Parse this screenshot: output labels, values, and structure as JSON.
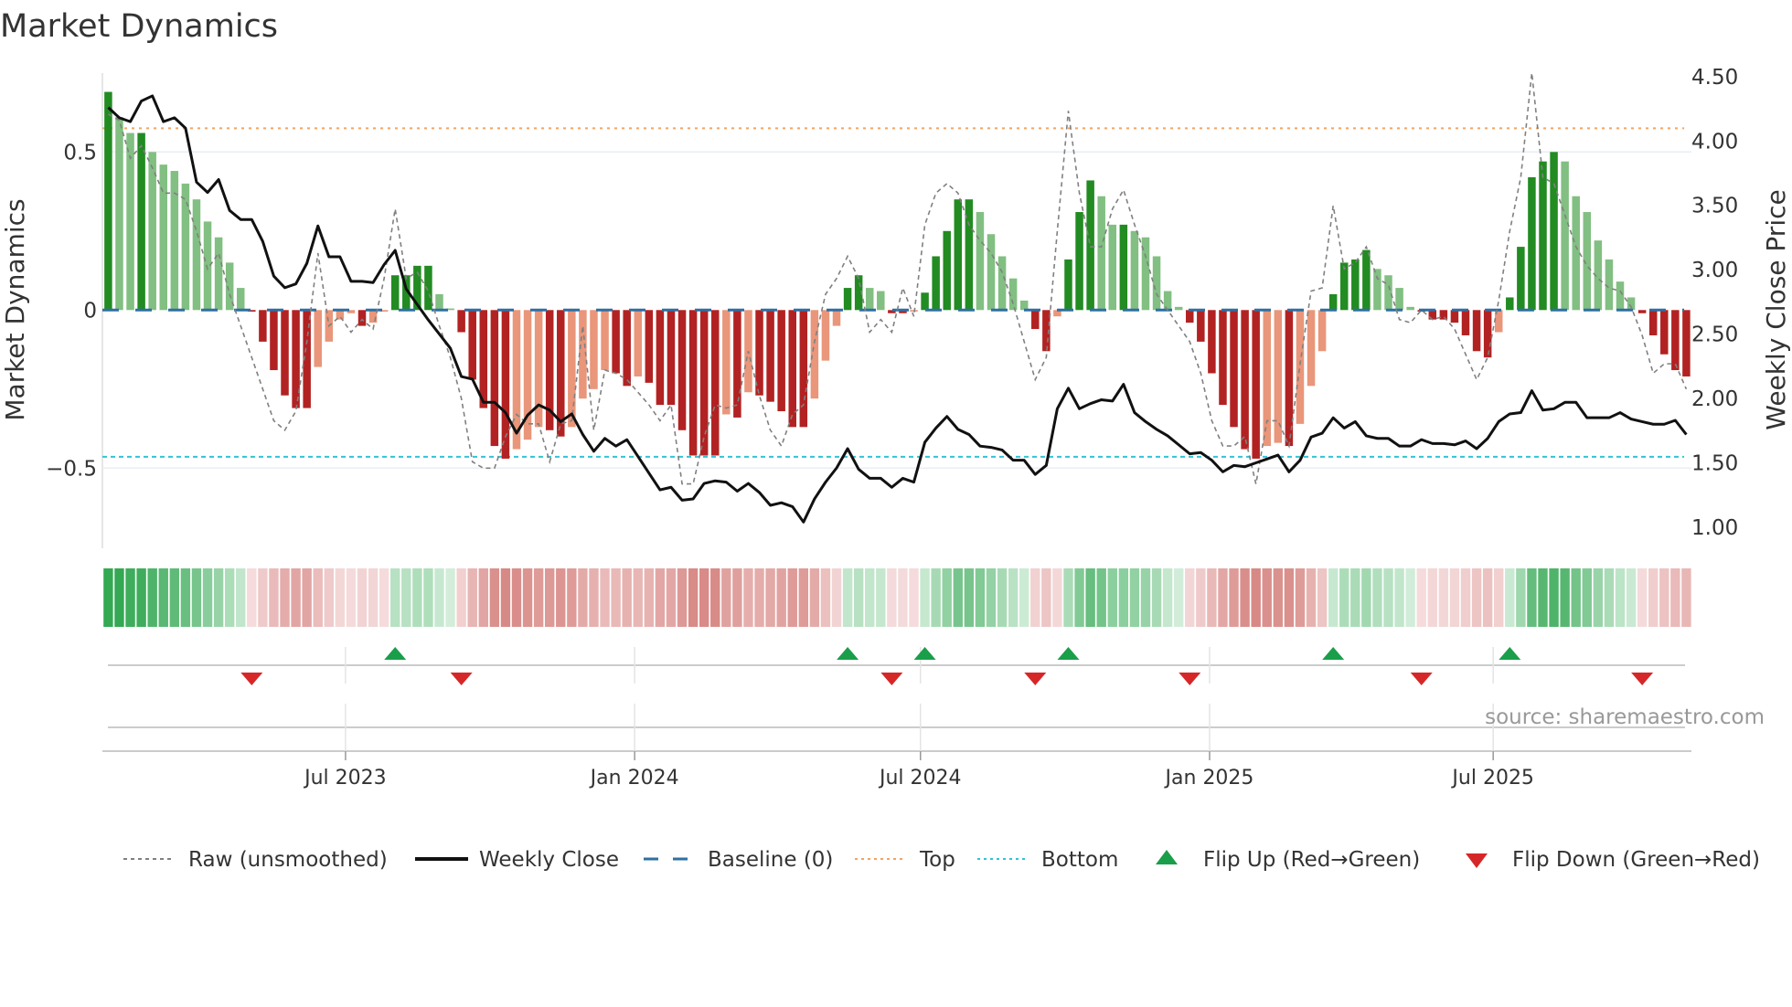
{
  "chart_data": {
    "type": "bar",
    "title": "Market Dynamics",
    "ylabel": "Market Dynamics",
    "ylabel_right": "Weekly Close Price",
    "ylim": [
      -0.75,
      0.75
    ],
    "ylim_right": [
      0.837,
      4.527
    ],
    "yticks": [
      {
        "v": 0.5,
        "label": "0.5"
      },
      {
        "v": 0,
        "label": "0"
      },
      {
        "v": -0.5,
        "label": "−0.5"
      }
    ],
    "yticks_right": [
      {
        "v": 4.5,
        "label": "4.50"
      },
      {
        "v": 4.0,
        "label": "4.00"
      },
      {
        "v": 3.5,
        "label": "3.50"
      },
      {
        "v": 3.0,
        "label": "3.00"
      },
      {
        "v": 2.5,
        "label": "2.50"
      },
      {
        "v": 2.0,
        "label": "2.00"
      },
      {
        "v": 1.5,
        "label": "1.50"
      },
      {
        "v": 1.0,
        "label": "1.00"
      }
    ],
    "xticks": [
      {
        "week": 21.5,
        "label": "Jul 2023"
      },
      {
        "week": 47.7,
        "label": "Jan 2024"
      },
      {
        "week": 73.6,
        "label": "Jul 2024"
      },
      {
        "week": 99.8,
        "label": "Jan 2025"
      },
      {
        "week": 125.5,
        "label": "Jul 2025"
      }
    ],
    "top_level": 0.575,
    "bottom_level": -0.464,
    "baseline": 0,
    "momentum": [
      0.69,
      0.61,
      0.56,
      0.56,
      0.5,
      0.46,
      0.44,
      0.4,
      0.35,
      0.28,
      0.23,
      0.15,
      0.07,
      -0.005,
      -0.1,
      -0.19,
      -0.27,
      -0.31,
      -0.31,
      -0.18,
      -0.1,
      -0.03,
      -0.01,
      -0.05,
      -0.04,
      -0.005,
      0.11,
      0.11,
      0.14,
      0.14,
      0.05,
      0.005,
      -0.07,
      -0.22,
      -0.31,
      -0.43,
      -0.47,
      -0.44,
      -0.41,
      -0.37,
      -0.38,
      -0.4,
      -0.37,
      -0.28,
      -0.25,
      -0.19,
      -0.2,
      -0.24,
      -0.21,
      -0.23,
      -0.3,
      -0.3,
      -0.38,
      -0.46,
      -0.46,
      -0.46,
      -0.33,
      -0.34,
      -0.26,
      -0.27,
      -0.29,
      -0.32,
      -0.37,
      -0.37,
      -0.28,
      -0.16,
      -0.05,
      0.07,
      0.11,
      0.07,
      0.06,
      -0.01,
      -0.01,
      -0.005,
      0.055,
      0.17,
      0.25,
      0.35,
      0.35,
      0.31,
      0.24,
      0.17,
      0.1,
      0.03,
      -0.06,
      -0.13,
      -0.02,
      0.16,
      0.31,
      0.41,
      0.36,
      0.27,
      0.27,
      0.25,
      0.23,
      0.17,
      0.06,
      0.01,
      -0.04,
      -0.1,
      -0.2,
      -0.3,
      -0.37,
      -0.44,
      -0.47,
      -0.43,
      -0.42,
      -0.43,
      -0.36,
      -0.24,
      -0.13,
      0.05,
      0.15,
      0.16,
      0.19,
      0.13,
      0.11,
      0.07,
      0.01,
      -0.005,
      -0.03,
      -0.03,
      -0.04,
      -0.08,
      -0.13,
      -0.15,
      -0.07,
      0.04,
      0.2,
      0.42,
      0.47,
      0.5,
      0.47,
      0.36,
      0.31,
      0.22,
      0.16,
      0.09,
      0.04,
      -0.01,
      -0.08,
      -0.14,
      -0.19,
      -0.21
    ],
    "raw": [
      0.62,
      0.6,
      0.48,
      0.52,
      0.45,
      0.37,
      0.37,
      0.35,
      0.25,
      0.13,
      0.18,
      0.05,
      -0.05,
      -0.15,
      -0.25,
      -0.35,
      -0.38,
      -0.32,
      -0.1,
      0.18,
      -0.05,
      -0.02,
      -0.07,
      -0.03,
      -0.06,
      0.1,
      0.32,
      0.1,
      0.12,
      0.06,
      -0.05,
      -0.15,
      -0.28,
      -0.48,
      -0.5,
      -0.5,
      -0.4,
      -0.33,
      -0.36,
      -0.36,
      -0.48,
      -0.36,
      -0.35,
      -0.05,
      -0.38,
      -0.19,
      -0.2,
      -0.22,
      -0.26,
      -0.3,
      -0.35,
      -0.3,
      -0.55,
      -0.55,
      -0.4,
      -0.3,
      -0.31,
      -0.3,
      -0.13,
      -0.27,
      -0.38,
      -0.43,
      -0.33,
      -0.3,
      -0.1,
      0.05,
      0.1,
      0.17,
      0.1,
      -0.07,
      -0.03,
      -0.07,
      0.07,
      -0.02,
      0.27,
      0.37,
      0.4,
      0.37,
      0.27,
      0.22,
      0.18,
      0.12,
      0.02,
      -0.1,
      -0.22,
      -0.15,
      0.25,
      0.63,
      0.37,
      0.2,
      0.2,
      0.32,
      0.38,
      0.27,
      0.17,
      0.05,
      0.0,
      -0.05,
      -0.1,
      -0.2,
      -0.35,
      -0.43,
      -0.43,
      -0.4,
      -0.55,
      -0.35,
      -0.35,
      -0.43,
      -0.17,
      0.06,
      0.07,
      0.33,
      0.13,
      0.15,
      0.2,
      0.1,
      0.08,
      -0.03,
      -0.04,
      0.0,
      -0.03,
      -0.02,
      -0.06,
      -0.14,
      -0.22,
      -0.15,
      0.03,
      0.25,
      0.42,
      0.75,
      0.42,
      0.4,
      0.3,
      0.2,
      0.14,
      0.1,
      0.07,
      0.06,
      0.01,
      -0.08,
      -0.2,
      -0.17,
      -0.17,
      -0.25
    ],
    "weekly_close": [
      4.26,
      4.18,
      4.15,
      4.31,
      4.35,
      4.15,
      4.18,
      4.1,
      3.68,
      3.6,
      3.7,
      3.46,
      3.39,
      3.39,
      3.22,
      2.95,
      2.86,
      2.89,
      3.05,
      3.34,
      3.1,
      3.1,
      2.91,
      2.91,
      2.9,
      3.04,
      3.15,
      2.85,
      2.73,
      2.61,
      2.5,
      2.39,
      2.17,
      2.15,
      1.97,
      1.97,
      1.89,
      1.73,
      1.87,
      1.95,
      1.91,
      1.82,
      1.88,
      1.72,
      1.59,
      1.69,
      1.63,
      1.68,
      1.55,
      1.42,
      1.29,
      1.31,
      1.21,
      1.22,
      1.34,
      1.36,
      1.35,
      1.28,
      1.34,
      1.27,
      1.17,
      1.19,
      1.16,
      1.04,
      1.22,
      1.35,
      1.46,
      1.61,
      1.45,
      1.38,
      1.38,
      1.31,
      1.38,
      1.35,
      1.66,
      1.77,
      1.86,
      1.76,
      1.72,
      1.63,
      1.62,
      1.6,
      1.52,
      1.52,
      1.41,
      1.48,
      1.92,
      2.08,
      1.92,
      1.96,
      1.99,
      1.98,
      2.11,
      1.89,
      1.82,
      1.76,
      1.71,
      1.64,
      1.57,
      1.58,
      1.52,
      1.43,
      1.48,
      1.47,
      1.5,
      1.53,
      1.56,
      1.43,
      1.52,
      1.7,
      1.73,
      1.85,
      1.77,
      1.82,
      1.71,
      1.69,
      1.69,
      1.63,
      1.63,
      1.68,
      1.65,
      1.65,
      1.64,
      1.67,
      1.61,
      1.69,
      1.82,
      1.88,
      1.89,
      2.06,
      1.91,
      1.92,
      1.97,
      1.97,
      1.85,
      1.85,
      1.85,
      1.89,
      1.84,
      1.82,
      1.8,
      1.8,
      1.83,
      1.72
    ],
    "flip_up_weeks": [
      26,
      67,
      74,
      87,
      111,
      127
    ],
    "flip_down_weeks": [
      13,
      32,
      71,
      84,
      98,
      119,
      139
    ],
    "colors": {
      "rising_positive": "#228b22",
      "falling_positive": "#82bf82",
      "falling_negative": "#b22222",
      "rising_negative": "#e9967a",
      "raw": "#808080",
      "close": "#111111",
      "baseline": "#2f6fa3",
      "top": "#f4a460",
      "bottom": "#30c4d6",
      "flip_up": "#1a9e4a",
      "flip_down": "#d62728"
    },
    "legend": {
      "placement": "bottom",
      "items": [
        "Raw (unsmoothed)",
        "Weekly Close",
        "Baseline (0)",
        "Top",
        "Bottom",
        "Flip Up (Red→Green)",
        "Flip Down (Green→Red)"
      ]
    },
    "source": "source: sharemaestro.com"
  }
}
